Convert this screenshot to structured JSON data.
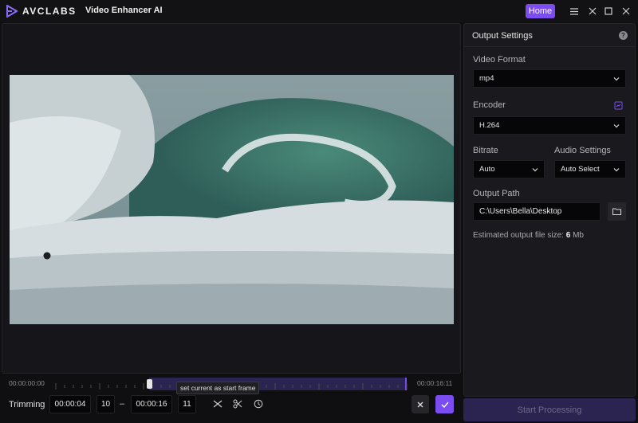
{
  "titlebar": {
    "brand": "AVCLABS",
    "app_name": "Video Enhancer AI",
    "home_label": "Home",
    "icons": [
      "menu-icon",
      "minimize-icon",
      "maximize-icon",
      "close-icon"
    ]
  },
  "colors": {
    "accent": "#7b4df0",
    "background": "#0f0f11",
    "panel": "#1a1a1e",
    "input": "#060608"
  },
  "timeline": {
    "start_time": "00:00:00:00",
    "end_time": "00:00:16:11",
    "tooltip": "set current as start frame"
  },
  "trimming": {
    "label": "Trimming",
    "start_time": "00:00:04",
    "start_frame": "10",
    "separator": "–",
    "end_time": "00:00:16",
    "end_frame": "11",
    "tools": [
      "split-icon",
      "cut-icon",
      "history-icon"
    ]
  },
  "settings": {
    "title": "Output Settings",
    "video_format": {
      "label": "Video Format",
      "value": "mp4"
    },
    "encoder": {
      "label": "Encoder",
      "value": "H.264"
    },
    "bitrate": {
      "label": "Bitrate",
      "value": "Auto"
    },
    "audio": {
      "label": "Audio Settings",
      "value": "Auto Select"
    },
    "output_path": {
      "label": "Output Path",
      "value": "C:\\Users\\Bella\\Desktop"
    },
    "estimate_prefix": "Estimated output file size:",
    "estimate_value": "6",
    "estimate_unit": "Mb"
  },
  "start_button": "Start Processing"
}
